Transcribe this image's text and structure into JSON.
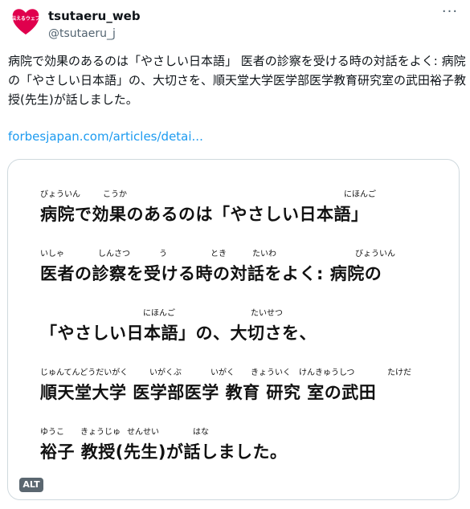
{
  "tweet": {
    "display_name": "tsutaeru_web",
    "handle": "@tsutaeru_j",
    "more_label": "···",
    "avatar_text": "伝えるウェブ",
    "text": "病院で効果のあるのは「やさしい日本語」 医者の診察を受ける時の対話をよく: 病院の「やさしい日本語」の、大切さを、順天堂大学医学部医学教育研究室の武田裕子教授(先生)が話しました。",
    "link": "forbesjapan.com/articles/detai..."
  },
  "image": {
    "alt_badge": "ALT",
    "lines": [
      {
        "text": "病院で効果のあるのは「やさしい日本語」",
        "ruby": [
          "びょういん",
          "こうか",
          "にほんご"
        ]
      },
      {
        "text": "医者の診察を受ける時の対話をよく: 病院の",
        "ruby": [
          "いしゃ",
          "しんさつ",
          "う",
          "とき",
          "たいわ",
          "びょういん"
        ]
      },
      {
        "text": "「やさしい日本語」の、大切さを、",
        "ruby": [
          "にほんご",
          "たいせつ"
        ]
      },
      {
        "text": "順天堂大学 医学部医学 教育 研究 室の武田",
        "ruby": [
          "じゅんてんどうだいがく",
          "いがくぶ",
          "いがく",
          "きょういく",
          "けんきゅうしつ",
          "たけだ"
        ]
      },
      {
        "text": "裕子 教授(先生)が話しました。",
        "ruby": [
          "ゆうこ",
          "きょうじゅ",
          "せんせい",
          "はな"
        ]
      }
    ]
  }
}
